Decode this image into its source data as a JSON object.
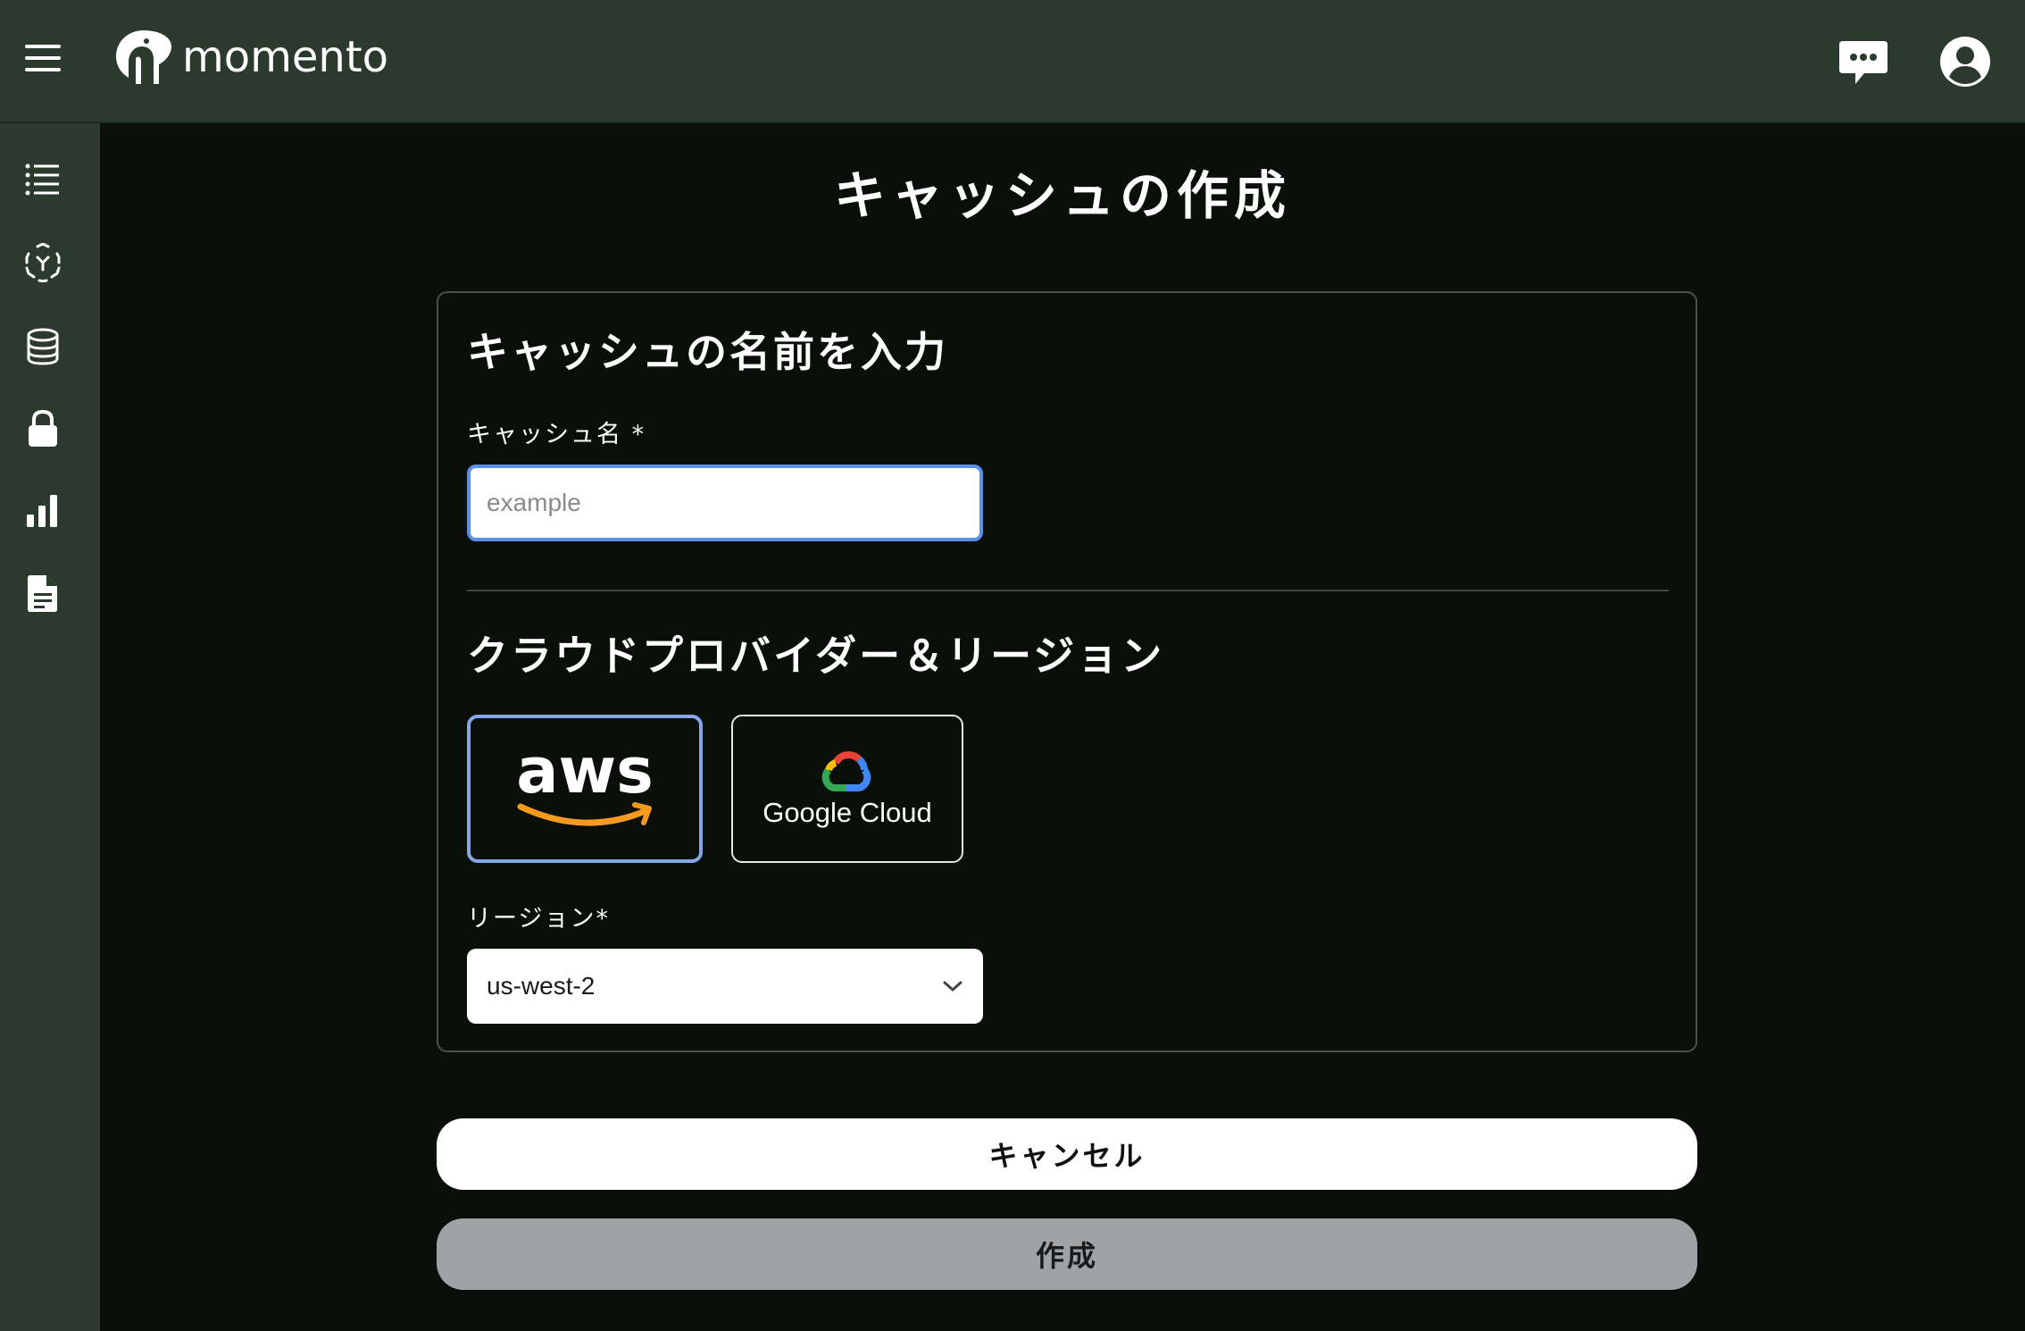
{
  "header": {
    "logo_text": "momento",
    "menu_icon": "hamburger-menu-icon",
    "chat_icon": "chat-bubble-icon",
    "account_icon": "account-circle-icon"
  },
  "sidebar": {
    "items": [
      {
        "icon": "list-icon"
      },
      {
        "icon": "topics-icon"
      },
      {
        "icon": "database-icon"
      },
      {
        "icon": "lock-icon"
      },
      {
        "icon": "bar-chart-icon"
      },
      {
        "icon": "document-icon"
      }
    ]
  },
  "page": {
    "title": "キャッシュの作成"
  },
  "form": {
    "name_section_title": "キャッシュの名前を入力",
    "name_label": "キャッシュ名 *",
    "name_value": "",
    "name_placeholder": "example",
    "provider_section_title": "クラウドプロバイダー＆リージョン",
    "providers": [
      {
        "id": "aws",
        "label": "aws",
        "selected": true
      },
      {
        "id": "gcp",
        "label": "Google Cloud",
        "selected": false
      }
    ],
    "region_label": "リージョン*",
    "region_value": "us-west-2"
  },
  "actions": {
    "cancel_label": "キャンセル",
    "create_label": "作成"
  },
  "colors": {
    "topbar": "#2b3a2c",
    "background": "#0a0f0a",
    "selected_border": "#86a6e8",
    "input_focus": "#5b8ee6",
    "aws_orange": "#f79a1e",
    "create_disabled": "#9fa3a6"
  }
}
